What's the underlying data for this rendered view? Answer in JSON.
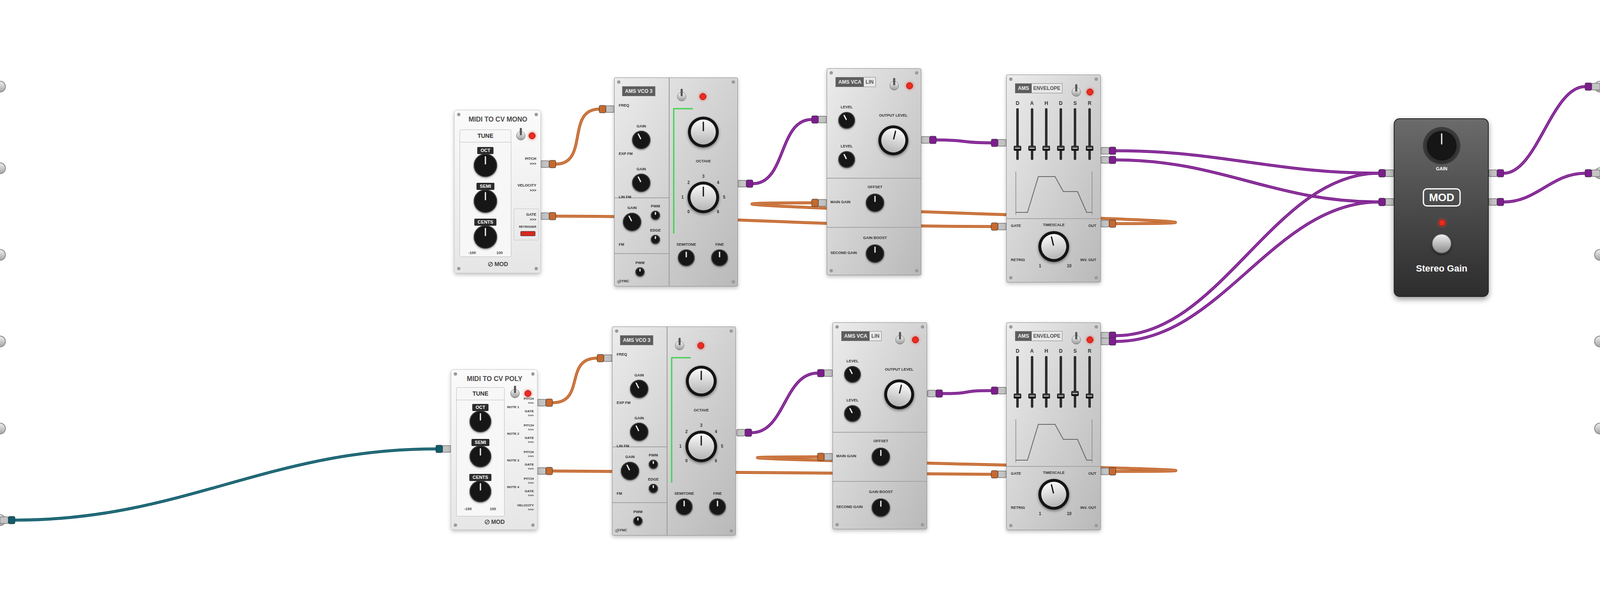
{
  "midiMono": {
    "title": "MIDI TO CV MONO",
    "tune": "TUNE",
    "on": true,
    "knobs": [
      {
        "label": "OCT",
        "level": 0.5
      },
      {
        "label": "SEMI",
        "level": 0.5
      },
      {
        "label": "CENTS",
        "level": 0.5
      }
    ],
    "range": [
      "-100",
      "100"
    ],
    "outputs": [
      {
        "label": "PITCH",
        "arrow": ">>>"
      },
      {
        "label": "VELOCITY",
        "arrow": ">>>"
      },
      {
        "label": "GATE",
        "arrow": ">>>"
      }
    ],
    "retrigger": {
      "label": "RETRIGGER",
      "on": true
    },
    "brand": "MOD"
  },
  "midiPoly": {
    "title": "MIDI TO CV POLY",
    "tune": "TUNE",
    "on": true,
    "knobs": [
      {
        "label": "OCT",
        "level": 0.5
      },
      {
        "label": "SEMI",
        "level": 0.5
      },
      {
        "label": "CENTS",
        "level": 0.5
      }
    ],
    "range": [
      "-100",
      "100"
    ],
    "notes": [
      {
        "label": "NOTE 1",
        "outputs": [
          {
            "label": "PITCH",
            "arrow": ">>>"
          },
          {
            "label": "GATE",
            "arrow": ">>>"
          }
        ]
      },
      {
        "label": "NOTE 2",
        "outputs": [
          {
            "label": "PITCH",
            "arrow": ">>>"
          },
          {
            "label": "GATE",
            "arrow": ">>>"
          }
        ]
      },
      {
        "label": "NOTE 3",
        "outputs": [
          {
            "label": "PITCH",
            "arrow": ">>>"
          },
          {
            "label": "GATE",
            "arrow": ">>>"
          }
        ]
      },
      {
        "label": "NOTE 4",
        "outputs": [
          {
            "label": "PITCH",
            "arrow": ">>>"
          },
          {
            "label": "GATE",
            "arrow": ">>>"
          }
        ]
      }
    ],
    "velocity": {
      "label": "VELOCITY",
      "arrow": ">>>"
    },
    "brand": "MOD"
  },
  "voices": [
    {
      "vco": {
        "title": "AMS VCO 3",
        "on": true,
        "inputs": [
          "FREQ",
          "EXP FM",
          "LIN FM",
          "FM",
          "SYNC"
        ],
        "knobs": [
          {
            "label": "GAIN",
            "level": 0.4
          },
          {
            "label": "GAIN",
            "level": 0.4
          },
          {
            "label": "GAIN",
            "level": 0.4
          },
          {
            "label": "PWM",
            "level": 0.5
          },
          {
            "label": "EDGE",
            "level": 0.5
          },
          {
            "label": "PWM",
            "level": 0.5
          },
          {
            "label": "SEMITONE",
            "level": 0.5
          },
          {
            "label": "FINE",
            "level": 0.5
          }
        ],
        "waveform": {
          "level": 0.5
        },
        "octave": {
          "label": "OCTAVE",
          "level": 0.5,
          "scale": [
            "0",
            "1",
            "2",
            "3",
            "4",
            "5",
            "6"
          ]
        }
      },
      "vca": {
        "title": "AMS VCA",
        "suffix": "LIN",
        "on": true,
        "knobs": [
          {
            "label": "LEVEL",
            "level": 0.4
          },
          {
            "label": "LEVEL",
            "level": 0.4
          },
          {
            "label": "OUTPUT LEVEL",
            "level": 0.55
          },
          {
            "label": "OFFSET",
            "level": 0.5
          },
          {
            "label": "GAIN BOOST",
            "level": 0.5
          }
        ],
        "inputs": [
          "MAIN GAIN",
          "SECOND GAIN"
        ]
      },
      "envelope": {
        "title": "AMS",
        "suffix": "ENVELOPE",
        "on": true,
        "sliders": [
          {
            "label": "D",
            "level": 0.2
          },
          {
            "label": "A",
            "level": 0.2
          },
          {
            "label": "H",
            "level": 0.2
          },
          {
            "label": "D",
            "level": 0.2
          },
          {
            "label": "S",
            "level": 0.2
          },
          {
            "label": "R",
            "level": 0.2
          }
        ],
        "gate": "GATE",
        "out": "OUT",
        "timescale": {
          "label": "TIMESCALE",
          "level": 0.45,
          "min": "1",
          "max": "10"
        },
        "retrig": "RETRIG",
        "invOut": "INV. OUT"
      }
    },
    {
      "vco": {
        "title": "AMS VCO 3",
        "on": true,
        "inputs": [
          "FREQ",
          "EXP FM",
          "LIN FM",
          "FM",
          "SYNC"
        ],
        "knobs": [
          {
            "label": "GAIN",
            "level": 0.4
          },
          {
            "label": "GAIN",
            "level": 0.4
          },
          {
            "label": "GAIN",
            "level": 0.4
          },
          {
            "label": "PWM",
            "level": 0.5
          },
          {
            "label": "EDGE",
            "level": 0.5
          },
          {
            "label": "PWM",
            "level": 0.5
          },
          {
            "label": "SEMITONE",
            "level": 0.5
          },
          {
            "label": "FINE",
            "level": 0.5
          }
        ],
        "waveform": {
          "level": 0.5
        },
        "octave": {
          "label": "OCTAVE",
          "level": 0.5,
          "scale": [
            "0",
            "1",
            "2",
            "3",
            "4",
            "5",
            "6"
          ]
        }
      },
      "vca": {
        "title": "AMS VCA",
        "suffix": "LIN",
        "on": true,
        "knobs": [
          {
            "label": "LEVEL",
            "level": 0.4
          },
          {
            "label": "LEVEL",
            "level": 0.4
          },
          {
            "label": "OUTPUT LEVEL",
            "level": 0.55
          },
          {
            "label": "OFFSET",
            "level": 0.5
          },
          {
            "label": "GAIN BOOST",
            "level": 0.5
          }
        ],
        "inputs": [
          "MAIN GAIN",
          "SECOND GAIN"
        ]
      },
      "envelope": {
        "title": "AMS",
        "suffix": "ENVELOPE",
        "on": true,
        "sliders": [
          {
            "label": "D",
            "level": 0.2
          },
          {
            "label": "A",
            "level": 0.2
          },
          {
            "label": "H",
            "level": 0.2
          },
          {
            "label": "D",
            "level": 0.2
          },
          {
            "label": "S",
            "level": 0.25
          },
          {
            "label": "R",
            "level": 0.2
          }
        ],
        "gate": "GATE",
        "out": "OUT",
        "timescale": {
          "label": "TIMESCALE",
          "level": 0.45,
          "min": "1",
          "max": "10"
        },
        "retrig": "RETRIG",
        "invOut": "INV. OUT"
      }
    }
  ],
  "stereoGain": {
    "label": "GAIN",
    "level": 0.5,
    "brand": "MOD",
    "on": true,
    "name": "Stereo Gain"
  },
  "cables": [
    {
      "kind": "cv",
      "color": "#c5692f"
    },
    {
      "kind": "cv",
      "color": "#c5692f"
    },
    {
      "kind": "cv",
      "color": "#c5692f"
    },
    {
      "kind": "audio",
      "color": "#7d1d8f"
    },
    {
      "kind": "audio",
      "color": "#7d1d8f"
    },
    {
      "kind": "audio",
      "color": "#7d1d8f"
    },
    {
      "kind": "audio",
      "color": "#7d1d8f"
    },
    {
      "kind": "cv",
      "color": "#c5692f"
    },
    {
      "kind": "cv",
      "color": "#c5692f"
    },
    {
      "kind": "cv",
      "color": "#c5692f"
    },
    {
      "kind": "audio",
      "color": "#7d1d8f"
    },
    {
      "kind": "audio",
      "color": "#7d1d8f"
    },
    {
      "kind": "audio",
      "color": "#7d1d8f"
    },
    {
      "kind": "audio",
      "color": "#7d1d8f"
    },
    {
      "kind": "midi",
      "color": "#0f5c6b"
    },
    {
      "kind": "audio",
      "color": "#7d1d8f"
    },
    {
      "kind": "audio",
      "color": "#7d1d8f"
    }
  ]
}
